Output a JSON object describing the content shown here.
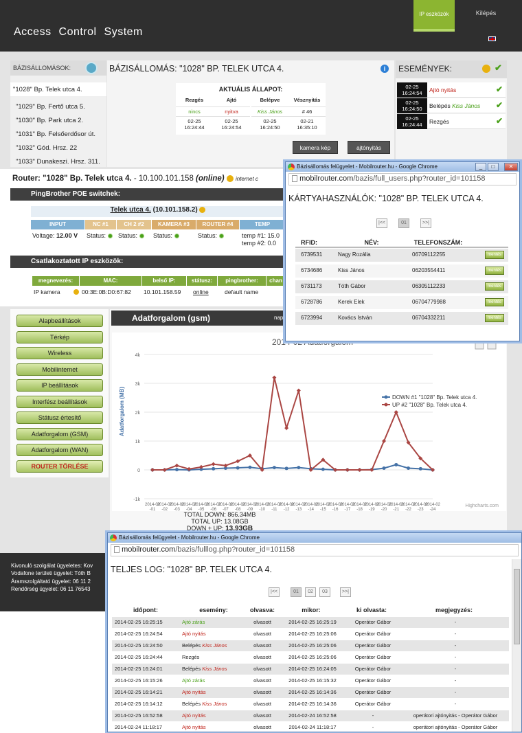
{
  "header": {
    "title": "Access Control System",
    "nav_ip": "IP eszközök",
    "nav_exit": "Kilépés"
  },
  "stations": {
    "label": "BÁZISÁLLOMÁSOK:",
    "items": [
      "\"1028\" Bp. Telek utca 4.",
      "\"1029\" Bp. Fertő utca 5.",
      "\"1030\" Bp. Park utca 2.",
      "\"1031\" Bp. Felsőerdősor út.",
      "\"1032\" Gód. Hrsz. 22",
      "\"1033\" Dunakeszi. Hrsz. 311."
    ]
  },
  "station": {
    "title": "BÁZISÁLLOMÁS: \"1028\" BP. TELEK UTCA 4.",
    "status_title": "AKTUÁLIS ÁLLAPOT:",
    "cols": [
      {
        "h": "Rezgés",
        "v": "nincs",
        "t1": "02-25",
        "t2": "16:24:44",
        "color": "#4aa019"
      },
      {
        "h": "Ajtó",
        "v": "nyitva",
        "t1": "02-25",
        "t2": "16:24:54",
        "color": "#c0241b"
      },
      {
        "h": "Belépve",
        "v": "Kiss János",
        "t1": "02-25",
        "t2": "16:24:50",
        "color": "#4aa019"
      },
      {
        "h": "Vésznyitás",
        "v": "# 46",
        "t1": "02-21",
        "t2": "16:35:10",
        "color": "#222"
      }
    ],
    "btn_camera": "kamera kép",
    "btn_door": "ajtónyitás"
  },
  "events": {
    "title": "ESEMÉNYEK:",
    "rows": [
      {
        "d": "02-25",
        "t": "16:24:54",
        "label": "Ajtó nyitás",
        "name": ""
      },
      {
        "d": "02-25",
        "t": "16:24:50",
        "label": "Belépés",
        "name": "Kiss János"
      },
      {
        "d": "02-25",
        "t": "16:24:44",
        "label": "Rezgés",
        "name": ""
      }
    ]
  },
  "router": {
    "title": "Router: \"1028\" Bp. Telek utca 4.",
    "ip": "- 10.100.101.158",
    "online": "(online)",
    "internet": "internet c",
    "poe_title": "PingBrother POE switchek:",
    "switch_link": "Telek utca 4.",
    "switch_ip": "(10.101.158.2)",
    "poe_headers": [
      "INPUT",
      "NC #1",
      "CH 2 #2",
      "KAMERA #3",
      "ROUTER #4",
      "TEMP"
    ],
    "voltage_label": "Voltage:",
    "voltage": "12.00 V",
    "status_label": "Status:",
    "temp1": "temp #1: 15.0",
    "temp2": "temp #2: 0.0",
    "ip_title": "Csatlakoztatott IP eszközök:",
    "ip_headers": [
      "megnevezés:",
      "MAC:",
      "belső IP:",
      "státusz:",
      "pingbrother:",
      "chan"
    ],
    "ip_row": {
      "name": "IP kamera",
      "mac": "00:3E:0B:D0:67:82",
      "ip": "10.101.158.59",
      "status": "online",
      "pb": "default name"
    }
  },
  "menu": [
    "Alapbeállítások",
    "Térkép",
    "Wireless",
    "Mobilinternet",
    "IP beállítások",
    "Interfész beállítások",
    "Státusz értesítő",
    "Adatforgalom (GSM)",
    "Adatforgalom (WAN)",
    "ROUTER TÖRLÉSE"
  ],
  "chart_header": {
    "title": "Adatforgalom (gsm)",
    "right": "nap"
  },
  "chart_data": {
    "type": "line",
    "title": "2014-02 Adatforgalom",
    "ylabel": "Adatforgalom (MB)",
    "ylim": [
      -1000,
      4000
    ],
    "yticks": [
      "-1k",
      "0",
      "1k",
      "2k",
      "3k",
      "4k"
    ],
    "x": [
      "2014-02-01",
      "2014-02-02",
      "2014-02-03",
      "2014-02-04",
      "2014-02-05",
      "2014-02-06",
      "2014-02-07",
      "2014-02-08",
      "2014-02-09",
      "2014-02-10",
      "2014-02-11",
      "2014-02-12",
      "2014-02-13",
      "2014-02-14",
      "2014-02-15",
      "2014-02-16",
      "2014-02-17",
      "2014-02-18",
      "2014-02-19",
      "2014-02-20",
      "2014-02-21",
      "2014-02-22",
      "2014-02-23",
      "2014-02-24"
    ],
    "series": [
      {
        "name": "DOWN #1 \"1028\" Bp. Telek utca 4.",
        "color": "#4572a7",
        "values": [
          0,
          0,
          10,
          0,
          20,
          40,
          60,
          70,
          90,
          40,
          80,
          50,
          80,
          40,
          20,
          0,
          0,
          0,
          10,
          60,
          180,
          60,
          40,
          0
        ]
      },
      {
        "name": "UP #2 \"1028\" Bp. Telek utca 4.",
        "color": "#aa4643",
        "values": [
          0,
          0,
          150,
          30,
          100,
          200,
          150,
          300,
          500,
          0,
          3200,
          1450,
          2750,
          0,
          350,
          0,
          0,
          0,
          0,
          1000,
          2000,
          950,
          400,
          0
        ]
      }
    ],
    "credit": "Highcharts.com"
  },
  "totals": {
    "down": "TOTAL DOWN: 866.34MB",
    "up": "TOTAL UP: 13.08GB",
    "sum_label": "DOWN + UP:",
    "sum": "13.93GB"
  },
  "footer": {
    "l1": "Kivonuló szolgálat ügyeletes: Kov",
    "l2": "Vodafone területi ügyelet: Tóth B",
    "l3": "Áramszolgáltató ügyelet: 06 11 2",
    "l4": "Rendőrség ügyelet: 06 11 76543"
  },
  "popup_users": {
    "wtitle": "Bázisállomás felügyelet - Mobilrouter.hu - Google Chrome",
    "url_host": "mobilrouter.com",
    "url_path": "/bazis/full_users.php?router_id=101158",
    "title": "KÁRTYAHASZNÁLÓK: \"1028\" BP. TELEK UTCA 4.",
    "pager": [
      "|<<",
      "01",
      ">>|"
    ],
    "headers": [
      "RFID:",
      "NÉV:",
      "TELEFONSZÁM:"
    ],
    "save": "mentés",
    "rows": [
      {
        "rfid": "6739531",
        "name": "Nagy Rozália",
        "phone": "06709112255"
      },
      {
        "rfid": "6734686",
        "name": "Kiss János",
        "phone": "06203554411"
      },
      {
        "rfid": "6731173",
        "name": "Tóth Gábor",
        "phone": "06305112233"
      },
      {
        "rfid": "6728786",
        "name": "Kerek Elek",
        "phone": "06704779988"
      },
      {
        "rfid": "6723994",
        "name": "Kovács István",
        "phone": "06704332211"
      }
    ]
  },
  "popup_log": {
    "wtitle": "Bázisállomás felügyelet - Mobilrouter.hu - Google Chrome",
    "url_host": "mobilrouter.com",
    "url_path": "/bazis/fulllog.php?router_id=101158",
    "title": "TELJES LOG: \"1028\" BP. TELEK UTCA 4.",
    "pager": [
      "|<<",
      "01",
      "02",
      "03",
      ">>|"
    ],
    "headers": [
      "időpont:",
      "esemény:",
      "olvasva:",
      "mikor:",
      "ki olvasta:",
      "megjegyzés:"
    ],
    "rows": [
      {
        "t": "2014-02-25 16:25:15",
        "e": "Ajtó zárás",
        "ec": "#4aa019",
        "n": "",
        "r": "olvasott",
        "m": "2014-02-25 16:25:19",
        "k": "Operátor Gábor",
        "c": "-"
      },
      {
        "t": "2014-02-25 16:24:54",
        "e": "Ajtó nyitás",
        "ec": "#c0241b",
        "n": "",
        "r": "olvasott",
        "m": "2014-02-25 16:25:06",
        "k": "Operátor Gábor",
        "c": "-"
      },
      {
        "t": "2014-02-25 16:24:50",
        "e": "Belépés",
        "ec": "#222",
        "n": "Kiss János",
        "r": "olvasott",
        "m": "2014-02-25 16:25:06",
        "k": "Operátor Gábor",
        "c": "-"
      },
      {
        "t": "2014-02-25 16:24:44",
        "e": "Rezgés",
        "ec": "#222",
        "n": "",
        "r": "olvasott",
        "m": "2014-02-25 16:25:06",
        "k": "Operátor Gábor",
        "c": "-"
      },
      {
        "t": "2014-02-25 16:24:01",
        "e": "Belépés",
        "ec": "#222",
        "n": "Kiss János",
        "r": "olvasott",
        "m": "2014-02-25 16:24:05",
        "k": "Operátor Gábor",
        "c": "-"
      },
      {
        "t": "2014-02-25 16:15:26",
        "e": "Ajtó zárás",
        "ec": "#4aa019",
        "n": "",
        "r": "olvasott",
        "m": "2014-02-25 16:15:32",
        "k": "Operátor Gábor",
        "c": "-"
      },
      {
        "t": "2014-02-25 16:14:21",
        "e": "Ajtó nyitás",
        "ec": "#c0241b",
        "n": "",
        "r": "olvasott",
        "m": "2014-02-25 16:14:36",
        "k": "Operátor Gábor",
        "c": "-"
      },
      {
        "t": "2014-02-25 16:14:12",
        "e": "Belépés",
        "ec": "#222",
        "n": "Kiss János",
        "r": "olvasott",
        "m": "2014-02-25 16:14:36",
        "k": "Operátor Gábor",
        "c": "-"
      },
      {
        "t": "2014-02-25 16:52:58",
        "e": "Ajtó nyitás",
        "ec": "#c0241b",
        "n": "",
        "r": "olvasott",
        "m": "2014-02-24 16:52:58",
        "k": "-",
        "c": "operátori ajtónyitás - Operátor Gábor"
      },
      {
        "t": "2014-02-24 11:18:17",
        "e": "Ajtó nyitás",
        "ec": "#c0241b",
        "n": "",
        "r": "olvasott",
        "m": "2014-02-24 11:18:17",
        "k": "-",
        "c": "operátori ajtónyitás - Operátor Gábor"
      }
    ]
  }
}
